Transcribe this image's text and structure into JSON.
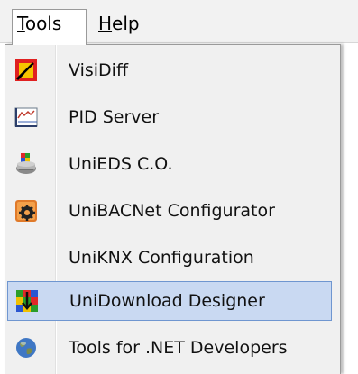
{
  "menubar": {
    "tools": {
      "label_ul": "T",
      "label_rest": "ools"
    },
    "help": {
      "label_ul": "H",
      "label_rest": "elp"
    }
  },
  "tools_menu": {
    "items": [
      {
        "label": "VisiDiff",
        "icon": "visidiff-icon"
      },
      {
        "label": "PID Server",
        "icon": "pid-chart-icon"
      },
      {
        "label": "UniEDS C.O.",
        "icon": "device-stack-icon"
      },
      {
        "label": "UniBACNet Configurator",
        "icon": "bacnet-gear-icon"
      },
      {
        "label": "UniKNX Configuration",
        "icon": ""
      },
      {
        "label": "UniDownload Designer",
        "icon": "download-grid-icon",
        "highlighted": true
      },
      {
        "label": "Tools for .NET Developers",
        "icon": "globe-icon"
      }
    ]
  },
  "colors": {
    "highlight_bg": "#c9d9f2",
    "highlight_border": "#6f96d0",
    "menu_bg": "#f0f0f0"
  }
}
